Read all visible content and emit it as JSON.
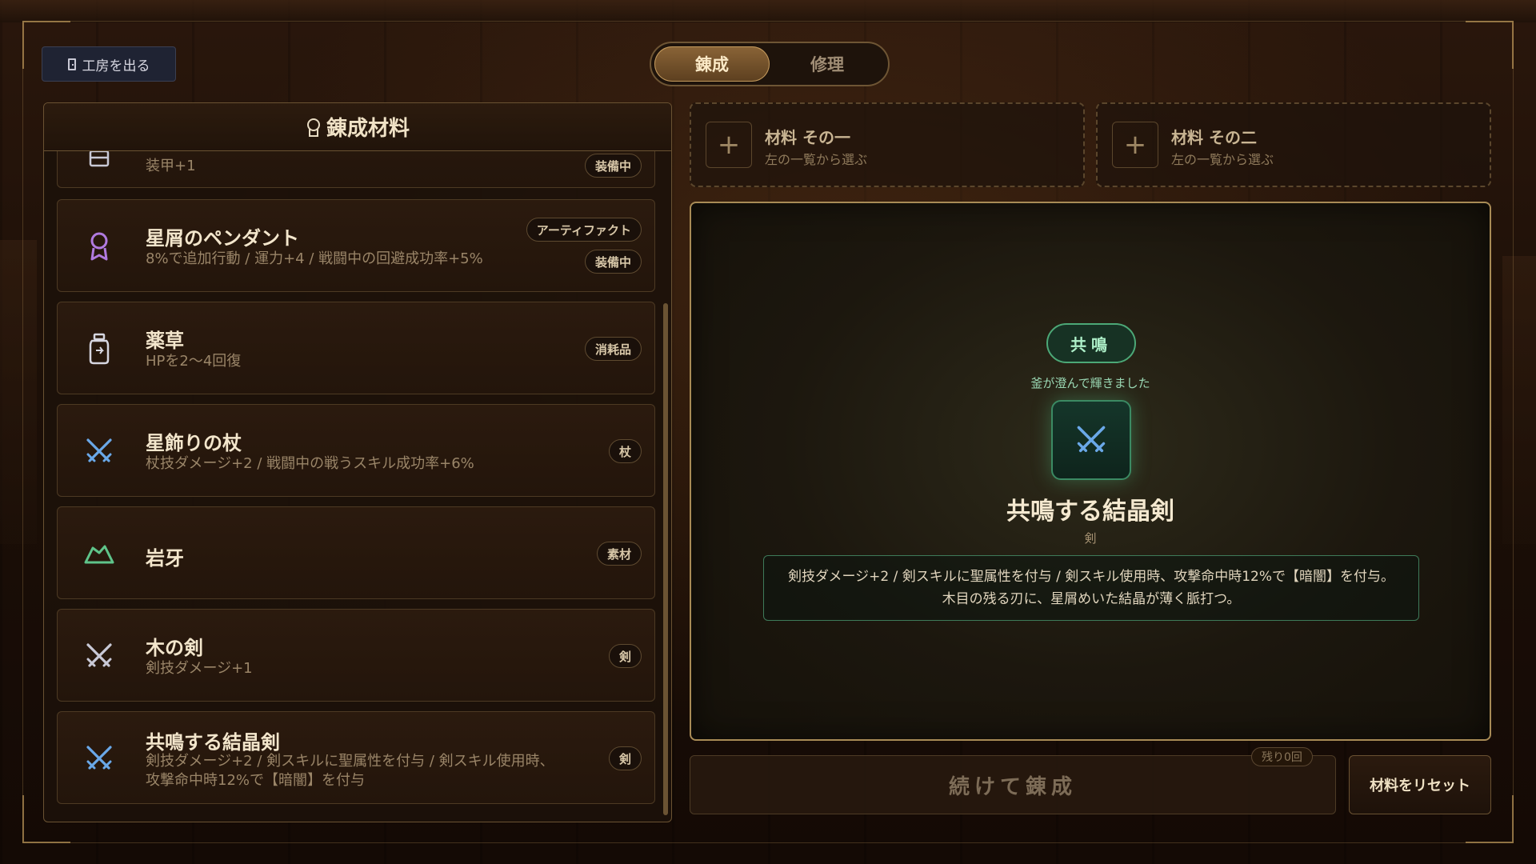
{
  "exit_button": {
    "label": "工房を出る",
    "icon": "door-icon"
  },
  "tabs": [
    {
      "label": "錬成",
      "active": true
    },
    {
      "label": "修理",
      "active": false
    }
  ],
  "materials_panel": {
    "title": "錬成材料",
    "icon": "medal-icon",
    "items": [
      {
        "name": "",
        "desc": "装甲+1",
        "tags": [
          "装備中"
        ],
        "icon": "armor-icon"
      },
      {
        "name": "星屑のペンダント",
        "desc": "8%で追加行動 / 運力+4 / 戦闘中の回避成功率+5%",
        "tags": [
          "アーティファクト",
          "装備中"
        ],
        "icon": "pendant-icon",
        "icon_color": "#b07adf"
      },
      {
        "name": "薬草",
        "desc": "HPを2〜4回復",
        "tags": [
          "消耗品"
        ],
        "icon": "potion-icon"
      },
      {
        "name": "星飾りの杖",
        "desc": "杖技ダメージ+2 / 戦闘中の戦うスキル成功率+6%",
        "tags": [
          "杖"
        ],
        "icon": "crossed-swords-icon",
        "icon_color": "#6aa8e8"
      },
      {
        "name": "岩牙",
        "desc": "",
        "tags": [
          "素材"
        ],
        "icon": "rock-icon",
        "icon_color": "#5fc48a"
      },
      {
        "name": "木の剣",
        "desc": "剣技ダメージ+1",
        "tags": [
          "剣"
        ],
        "icon": "crossed-swords-icon",
        "icon_color": "#c9c9d6"
      },
      {
        "name": "共鳴する結晶剣",
        "desc": "剣技ダメージ+2 / 剣スキルに聖属性を付与 / 剣スキル使用時、攻撃命中時12%で【暗闇】を付与",
        "tags": [
          "剣"
        ],
        "icon": "crossed-swords-icon",
        "icon_color": "#6aa8e8"
      }
    ]
  },
  "slots": [
    {
      "title": "材料 その一",
      "subtitle": "左の一覧から選ぶ"
    },
    {
      "title": "材料 その二",
      "subtitle": "左の一覧から選ぶ"
    }
  ],
  "result": {
    "badge": "共鳴",
    "subtitle": "釜が澄んで輝きました",
    "icon": "crossed-swords-icon",
    "name": "共鳴する結晶剣",
    "type": "剣",
    "description": "剣技ダメージ+2 / 剣スキルに聖属性を付与 / 剣スキル使用時、攻撃命中時12%で【暗闇】を付与。木目の残る刃に、星屑めいた結晶が薄く脈打つ。"
  },
  "actions": {
    "continue_label": "続けて錬成",
    "remaining_label": "残り0回",
    "reset_label": "材料をリセット"
  },
  "colors": {
    "accent_gold": "#a88b56",
    "accent_green": "#4ca877",
    "sword_blue": "#6aa8e8"
  }
}
